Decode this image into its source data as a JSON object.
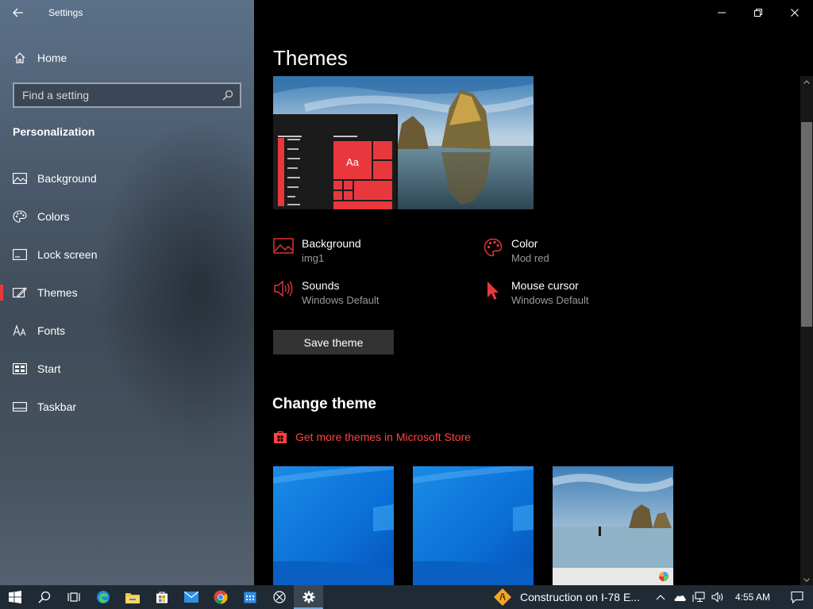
{
  "window": {
    "title": "Settings"
  },
  "sidebar": {
    "home_label": "Home",
    "search_placeholder": "Find a setting",
    "section_title": "Personalization",
    "items": [
      {
        "label": "Background",
        "icon": "image-icon"
      },
      {
        "label": "Colors",
        "icon": "palette-icon"
      },
      {
        "label": "Lock screen",
        "icon": "lock-screen-icon"
      },
      {
        "label": "Themes",
        "icon": "themes-icon",
        "selected": true
      },
      {
        "label": "Fonts",
        "icon": "fonts-icon"
      },
      {
        "label": "Start",
        "icon": "start-icon"
      },
      {
        "label": "Taskbar",
        "icon": "taskbar-icon"
      }
    ]
  },
  "main": {
    "title": "Themes",
    "preview_tile_text": "Aa",
    "properties": [
      {
        "name": "Background",
        "value": "img1",
        "icon": "picture-icon"
      },
      {
        "name": "Color",
        "value": "Mod red",
        "icon": "palette-icon"
      },
      {
        "name": "Sounds",
        "value": "Windows Default",
        "icon": "speaker-icon"
      },
      {
        "name": "Mouse cursor",
        "value": "Windows Default",
        "icon": "cursor-icon"
      }
    ],
    "save_label": "Save theme",
    "change_title": "Change theme",
    "store_link": "Get more themes in Microsoft Store"
  },
  "taskbar": {
    "news_text": "Construction on I-78 E...",
    "clock": "4:55 AM"
  },
  "colors": {
    "accent": "#e8383d",
    "link": "#ff4343",
    "taskbar": "#1f2a35"
  }
}
